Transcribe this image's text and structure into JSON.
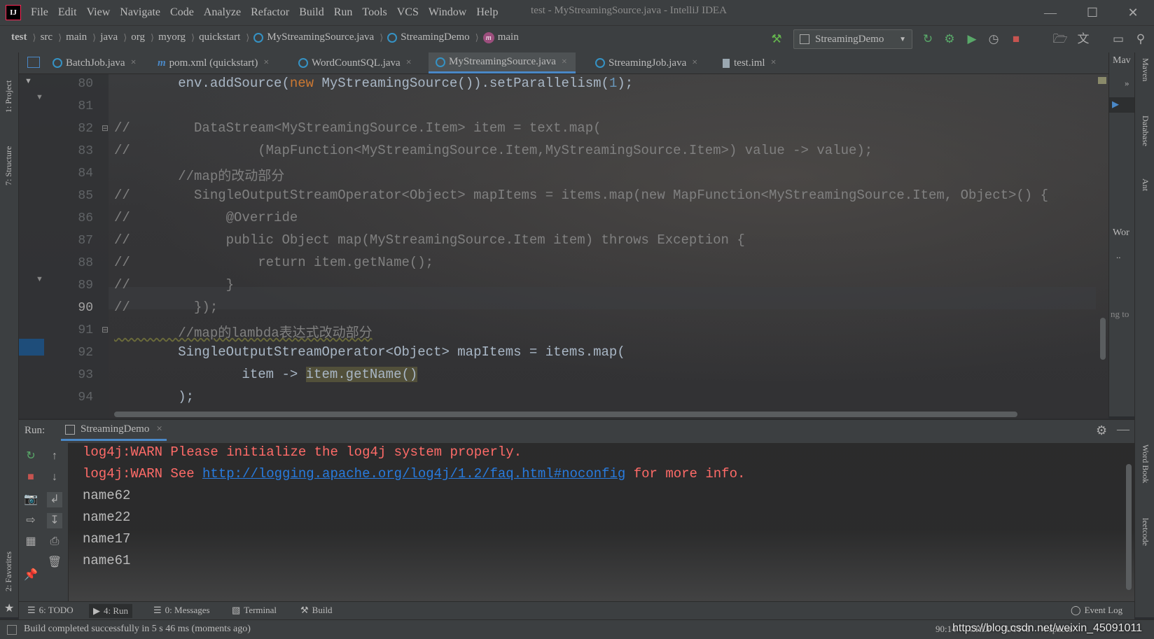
{
  "menubar": {
    "items": [
      "File",
      "Edit",
      "View",
      "Navigate",
      "Code",
      "Analyze",
      "Refactor",
      "Build",
      "Run",
      "Tools",
      "VCS",
      "Window",
      "Help"
    ],
    "title": "test - MyStreamingSource.java - IntelliJ IDEA"
  },
  "breadcrumb": {
    "items": [
      "test",
      "src",
      "main",
      "java",
      "org",
      "myorg",
      "quickstart",
      "MyStreamingSource.java",
      "StreamingDemo",
      "main"
    ]
  },
  "run_config": "StreamingDemo",
  "tabs": [
    {
      "label": "BatchJob.java"
    },
    {
      "label": "pom.xml (quickstart)"
    },
    {
      "label": "WordCountSQL.java"
    },
    {
      "label": "MyStreamingSource.java"
    },
    {
      "label": "StreamingJob.java"
    },
    {
      "label": "test.iml"
    }
  ],
  "left_tools": {
    "project": "1: Project",
    "structure": "7: Structure",
    "favorites": "2: Favorites"
  },
  "right_tools": {
    "maven": "Maven",
    "database": "Database",
    "ant": "Ant",
    "wordbook": "Word Book",
    "leetcode": "leetcode"
  },
  "right_pane": {
    "maven_label": "Mav",
    "wor_label": "Wor",
    "ng_label": "ng to"
  },
  "editor": {
    "line_numbers": [
      "80",
      "81",
      "82",
      "83",
      "84",
      "85",
      "86",
      "87",
      "88",
      "89",
      "90",
      "91",
      "92",
      "93",
      "94"
    ],
    "lines": {
      "l80_a": "        env.addSource(",
      "l80_kw": "new",
      "l80_b": " MyStreamingSource()).setParallelism(",
      "l80_num": "1",
      "l80_c": ");",
      "l82": "//        DataStream<MyStreamingSource.Item> item = text.map(",
      "l83": "//                (MapFunction<MyStreamingSource.Item,MyStreamingSource.Item>) value -> value);",
      "l84": "        //map的改动部分",
      "l85": "//        SingleOutputStreamOperator<Object> mapItems = items.map(new MapFunction<MyStreamingSource.Item, Object>() {",
      "l86": "//            @Override",
      "l87": "//            public Object map(MyStreamingSource.Item item) throws Exception {",
      "l88": "//                return item.getName();",
      "l89": "//            }",
      "l90": "//        });",
      "l91": "        //map的lambda表达式改动部分",
      "l92": "        SingleOutputStreamOperator<Object> mapItems = items.map(",
      "l93_a": "                item -> ",
      "l93_hl": "item.getName()",
      "l94": "        );"
    }
  },
  "run_panel": {
    "label": "Run:",
    "tab": "StreamingDemo",
    "console": {
      "warn1": "log4j:WARN Please initialize the log4j system properly.",
      "warn2_a": "log4j:WARN See ",
      "warn2_link": "http://logging.apache.org/log4j/1.2/faq.html#noconfig",
      "warn2_b": " for more info.",
      "out": [
        "name62",
        "name22",
        "name17",
        "name61"
      ]
    }
  },
  "bottom_tools": {
    "todo": "6: TODO",
    "run": "4: Run",
    "messages": "0: Messages",
    "terminal": "Terminal",
    "build": "Build",
    "event_log": "Event Log"
  },
  "status": {
    "message": "Build completed successfully in 5 s 46 ms (moments ago)",
    "position": "90:14",
    "line_sep": "CRLF",
    "encoding": "UTF-8",
    "indent": "4 spaces",
    "watermark": "https://blog.csdn.net/weixin_45091011"
  }
}
